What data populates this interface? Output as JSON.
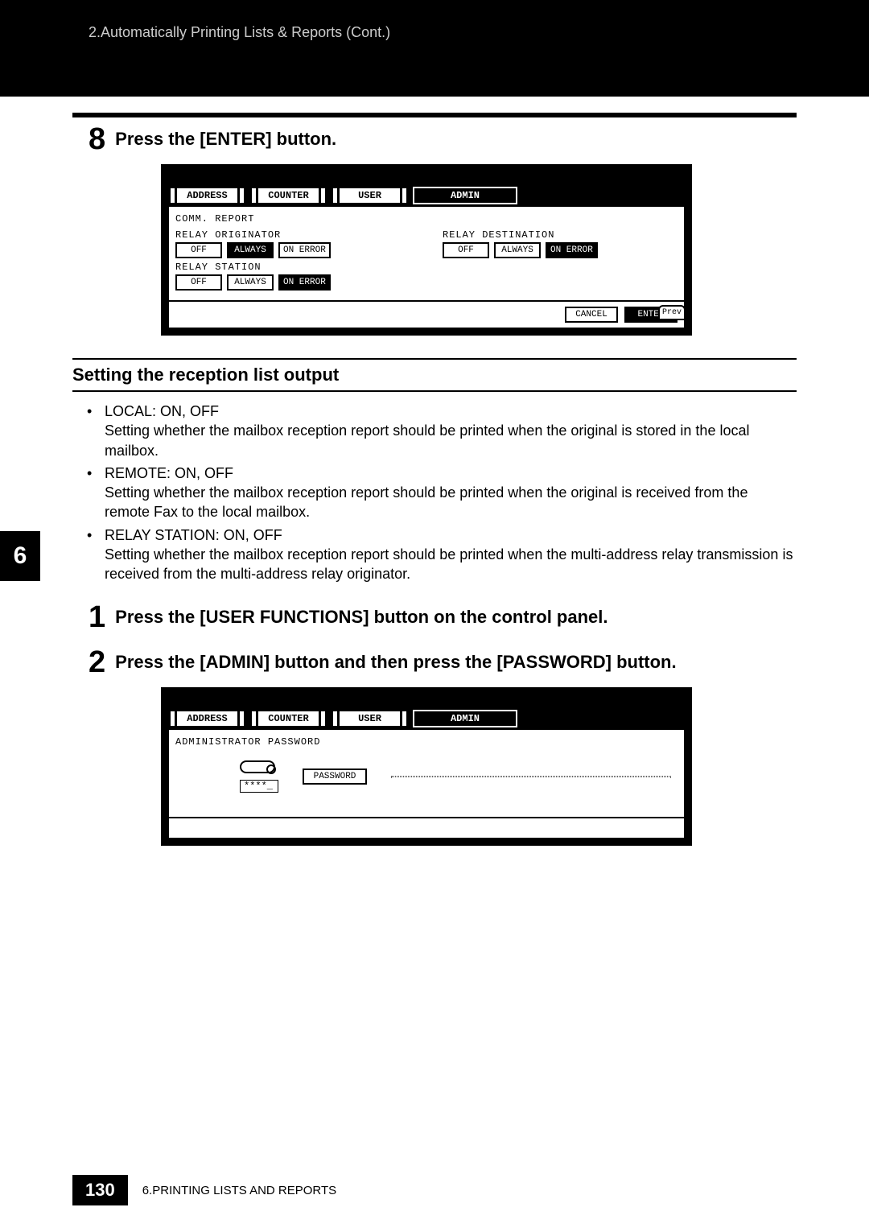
{
  "header": {
    "breadcrumb": "2.Automatically Printing Lists & Reports (Cont.)"
  },
  "step8": {
    "num": "8",
    "text": "Press the [ENTER] button."
  },
  "screenshot1": {
    "tabs": {
      "address": "ADDRESS",
      "counter": "COUNTER",
      "user": "USER",
      "admin": "ADMIN"
    },
    "comm_report": "COMM. REPORT",
    "relay_originator": "RELAY ORIGINATOR",
    "relay_destination": "RELAY DESTINATION",
    "relay_station": "RELAY STATION",
    "off": "OFF",
    "always": "ALWAYS",
    "on_error": "ON ERROR",
    "cancel": "CANCEL",
    "enter": "ENTER",
    "prev": "Prev"
  },
  "section": {
    "title": "Setting the reception list output",
    "items": [
      {
        "head": "LOCAL: ON, OFF",
        "body": "Setting whether the mailbox reception report should be printed when the original is stored in the local mailbox."
      },
      {
        "head": "REMOTE: ON, OFF",
        "body": "Setting whether the mailbox reception report should be printed when the original is received from the remote Fax to the local mailbox."
      },
      {
        "head": "RELAY STATION: ON, OFF",
        "body": "Setting whether the mailbox reception report should be printed when the multi-address relay transmission is received from the multi-address relay originator."
      }
    ]
  },
  "step1": {
    "num": "1",
    "text": "Press the [USER FUNCTIONS] button on the control panel."
  },
  "step2": {
    "num": "2",
    "text": "Press the [ADMIN] button and then press the [PASSWORD] button."
  },
  "screenshot2": {
    "admin_password": "ADMINISTRATOR PASSWORD",
    "password_btn": "PASSWORD",
    "stars": "****_"
  },
  "chapter_tab": "6",
  "footer": {
    "page": "130",
    "text": "6.PRINTING LISTS AND REPORTS"
  }
}
